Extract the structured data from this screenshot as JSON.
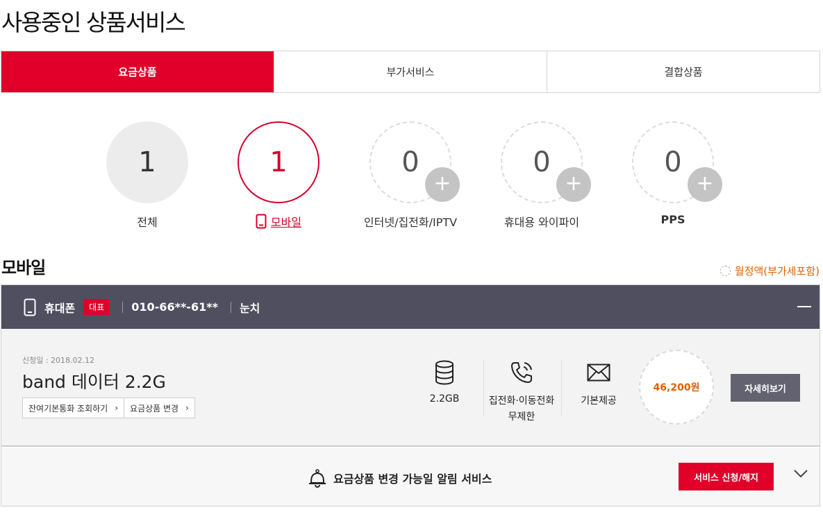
{
  "page_title": "사용중인 상품서비스",
  "tabs": [
    {
      "label": "요금상품",
      "active": true
    },
    {
      "label": "부가서비스",
      "active": false
    },
    {
      "label": "결합상품",
      "active": false
    }
  ],
  "categories": [
    {
      "count": "1",
      "label": "전체"
    },
    {
      "count": "1",
      "label": "모바일"
    },
    {
      "count": "0",
      "label": "인터넷/집전화/IPTV",
      "plus": "+"
    },
    {
      "count": "0",
      "label": "휴대용 와이파이",
      "plus": "+"
    },
    {
      "count": "0",
      "label": "PPS",
      "plus": "+"
    }
  ],
  "section": {
    "title": "모바일",
    "monthly_label": "월정액(부가세포함)"
  },
  "card": {
    "device": "휴대폰",
    "badge": "대표",
    "phone": "010-66**-61**",
    "nickname": "눈치",
    "apply_date": "신청일 : 2018.02.12",
    "plan": "band 데이터 2.2G",
    "btn_remaining": "잔여기본통화 조회하기",
    "btn_change": "요금상품 변경",
    "features": [
      {
        "icon": "database-icon",
        "label": "2.2GB"
      },
      {
        "icon": "phone-call-icon",
        "label_line1": "집전화·이동전화",
        "label_line2": "무제한"
      },
      {
        "icon": "envelope-icon",
        "label": "기본제공"
      }
    ],
    "price": "46,200원",
    "detail_button": "자세히보기",
    "notice": "요금상품 변경 가능일 알림 서비스",
    "service_button": "서비스 신청/해지"
  },
  "colors": {
    "brand_red": "#e0002a",
    "header_dark": "#4f4f5f",
    "price_orange": "#e06000"
  }
}
